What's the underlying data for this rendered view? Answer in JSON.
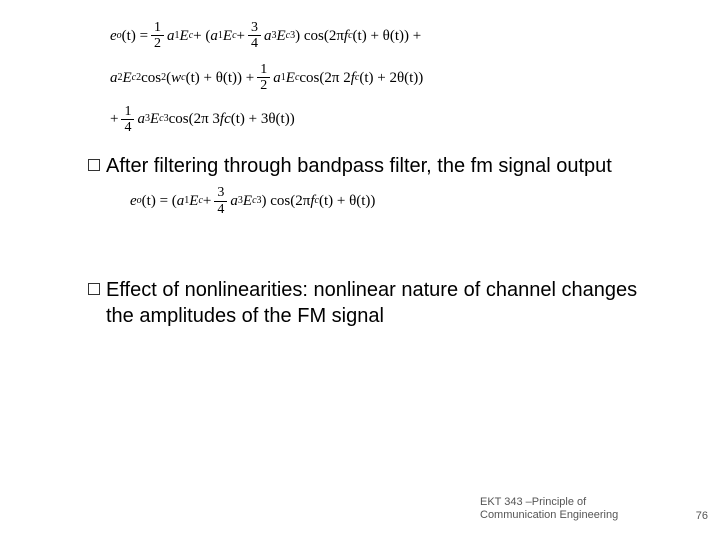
{
  "equations": {
    "main": {
      "lhs": "e",
      "lhs_sub": "o",
      "lhs_arg": "(t) =",
      "line1_a": "a",
      "line1_a_sub": "1",
      "line1_E": "E",
      "line1_E_sub": "c",
      "line1_plus1": " + (",
      "line1_a2": "a",
      "line1_a2_sub": "1",
      "line1_E2": "E",
      "line1_E2_sub": "c",
      "line1_plus2": " + ",
      "line1_a3": "a",
      "line1_a3_sub": "3",
      "line1_E3": "E",
      "line1_E3_sub": "c",
      "line1_E3_sup": "3",
      "line1_close": ") cos(2π",
      "line1_f": "f",
      "line1_f_sub": "c",
      "line1_tail": "(t) + θ(t)) +",
      "line2_a": "a",
      "line2_a_sub": "2",
      "line2_E": "E",
      "line2_E_sub": "c",
      "line2_E_sup": "2",
      "line2_cos": " cos",
      "line2_cos_sup": "2",
      "line2_open": "(",
      "line2_w": "w",
      "line2_w_sub": "c",
      "line2_mid": "(t) + θ(t)) + ",
      "line2_a1": "a",
      "line2_a1_sub": "1",
      "line2_E1": "E",
      "line2_E1_sub": "c",
      "line2_cos2": " cos(2π 2",
      "line2_f": "f",
      "line2_f_sub": "c",
      "line2_tail": "(t) + 2θ(t))",
      "line3_plus": "+ ",
      "line3_a": "a",
      "line3_a_sub": "3",
      "line3_E": "E",
      "line3_E_sub": "c",
      "line3_E_sup": "3",
      "line3_cos": " cos(2π 3",
      "line3_fc": "fc",
      "line3_tail": "(t) + 3θ(t))"
    },
    "filtered": {
      "lhs": "e",
      "lhs_sub": "o",
      "lhs_arg": "(t) = (",
      "a1": "a",
      "a1_sub": "1",
      "E1": "E",
      "E1_sub": "c",
      "plus": " + ",
      "a3": "a",
      "a3_sub": "3",
      "E3": "E",
      "E3_sub": "c",
      "E3_sup": "3",
      "close": ") cos(2π",
      "f": "f",
      "f_sub": "c",
      "tail": "(t) + θ(t))"
    },
    "fracs": {
      "one": "1",
      "two": "2",
      "three": "3",
      "four": "4"
    }
  },
  "bullets": {
    "b1": "After filtering through bandpass filter, the fm signal output",
    "b2": "Effect of nonlinearities: nonlinear nature of channel changes the amplitudes of the FM signal"
  },
  "footer": {
    "course": "EKT 343 –Principle of Communication Engineering",
    "page": "76"
  }
}
